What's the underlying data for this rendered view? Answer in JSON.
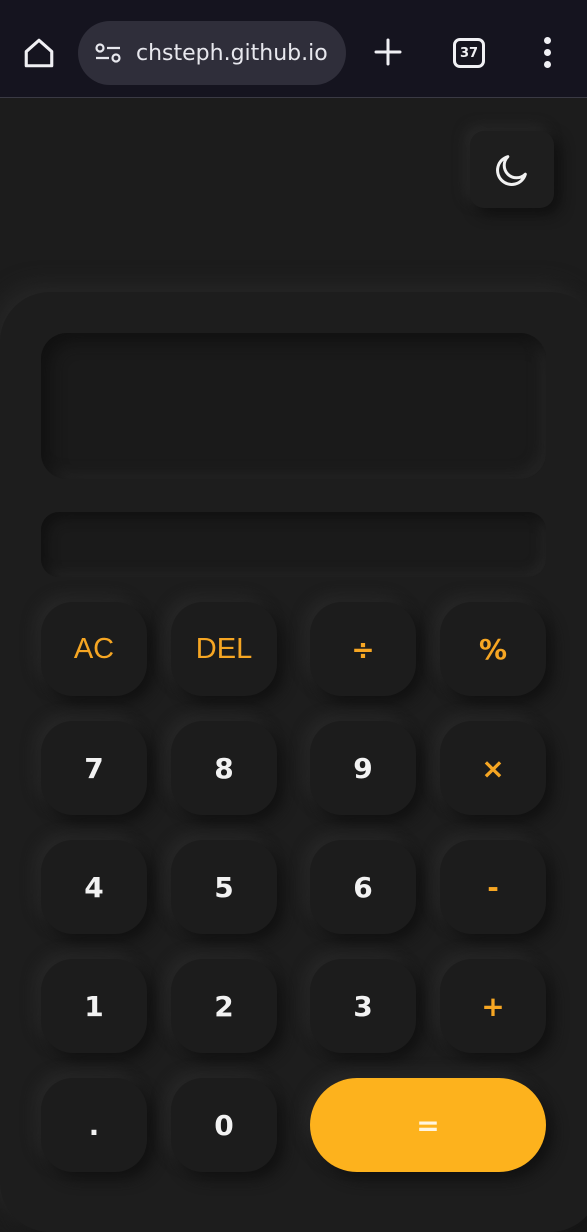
{
  "browser": {
    "url": "chsteph.github.io",
    "tab_count": "37",
    "icons": {
      "home": "home-icon",
      "site_settings": "tune-icon",
      "new_tab": "plus-icon",
      "menu": "more-vertical-icon"
    }
  },
  "page": {
    "theme_toggle_icon": "moon-icon",
    "display": {
      "main_value": "",
      "previous_value": ""
    },
    "keys": {
      "ac": "AC",
      "del": "DEL",
      "divide": "÷",
      "percent": "%",
      "seven": "7",
      "eight": "8",
      "nine": "9",
      "multiply": "×",
      "four": "4",
      "five": "5",
      "six": "6",
      "minus": "-",
      "one": "1",
      "two": "2",
      "three": "3",
      "plus": "+",
      "dot": ".",
      "zero": "0",
      "equals": "="
    },
    "colors": {
      "background": "#1c1c1c",
      "accent": "#f6a623",
      "equals_button": "#fdb21d",
      "digit_text": "#f2f2f2"
    }
  }
}
